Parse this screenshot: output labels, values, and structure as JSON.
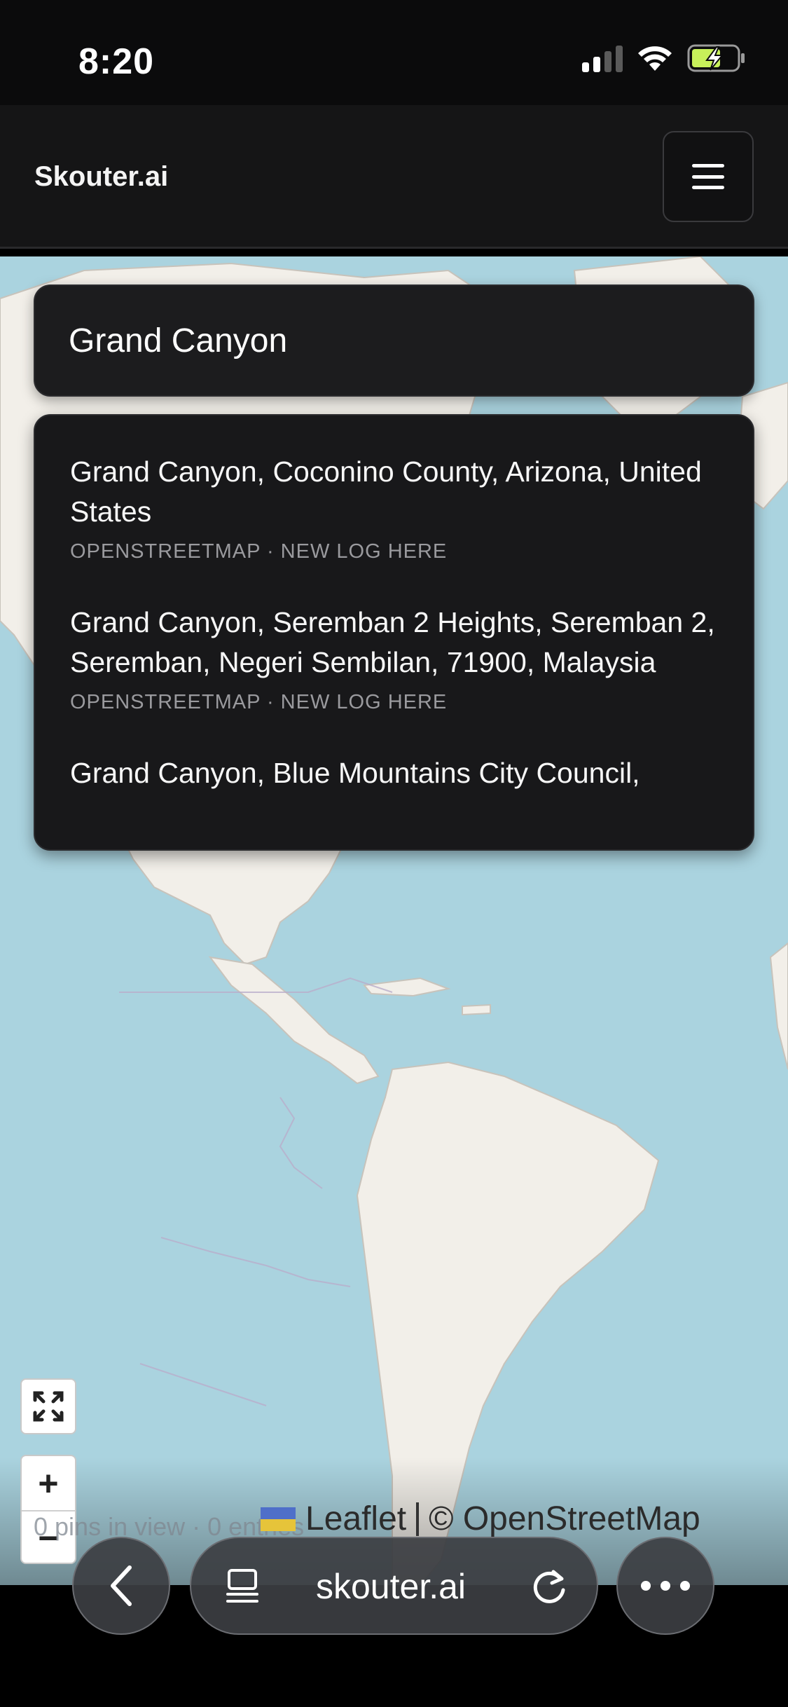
{
  "status_bar": {
    "time": "8:20"
  },
  "header": {
    "brand": "Skouter.ai",
    "menu_icon": "hamburger-icon"
  },
  "search": {
    "value": "Grand Canyon"
  },
  "results": [
    {
      "title": "Grand Canyon, Coconino County, Arizona, United States",
      "meta": "OPENSTREETMAP · NEW LOG HERE"
    },
    {
      "title": "Grand Canyon, Seremban 2 Heights, Seremban 2, Seremban, Negeri Sembilan, 71900, Malaysia",
      "meta": "OPENSTREETMAP · NEW LOG HERE"
    },
    {
      "title": "Grand Canyon, Blue Mountains City Council,",
      "meta": ""
    }
  ],
  "map": {
    "zoom_in": "+",
    "zoom_out": "−",
    "stats": "0 pins in view · 0 entries",
    "attribution_leaflet": "Leaflet",
    "attribution_osm": "© OpenStreetMap",
    "colors": {
      "water": "#aad3df",
      "land": "#f2efe9"
    }
  },
  "browser": {
    "url": "skouter.ai"
  }
}
